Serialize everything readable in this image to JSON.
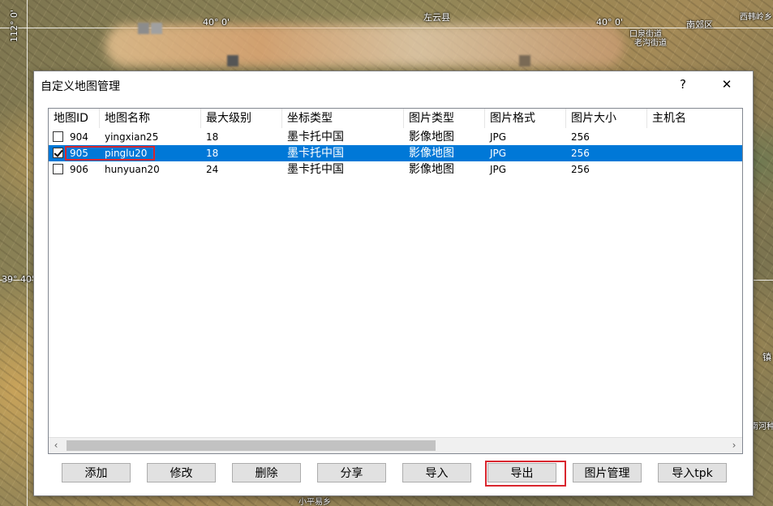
{
  "map": {
    "labels": [
      {
        "text": "40° 0'"
      },
      {
        "text": "左云县"
      },
      {
        "text": "40° 0'"
      },
      {
        "text": "南郊区"
      },
      {
        "text": "西韩岭乡"
      },
      {
        "text": "口泉街道"
      },
      {
        "text": "老沟街道"
      },
      {
        "text": "112° 0'"
      },
      {
        "text": "39° 40'"
      },
      {
        "text": "镇"
      },
      {
        "text": "南河种"
      },
      {
        "text": "小平易乡"
      }
    ]
  },
  "dialog": {
    "title": "自定义地图管理",
    "help_label": "?",
    "close_label": "✕",
    "columns": [
      "地图ID",
      "地图名称",
      "最大级别",
      "坐标类型",
      "图片类型",
      "图片格式",
      "图片大小",
      "主机名"
    ],
    "rows": [
      {
        "checked": false,
        "id": "904",
        "name": "yingxian25",
        "max_level": "18",
        "coord_type": "墨卡托中国",
        "image_type": "影像地图",
        "format": "JPG",
        "size": "256",
        "host": "",
        "selected": false
      },
      {
        "checked": true,
        "id": "905",
        "name": "pinglu20",
        "max_level": "18",
        "coord_type": "墨卡托中国",
        "image_type": "影像地图",
        "format": "JPG",
        "size": "256",
        "host": "",
        "selected": true
      },
      {
        "checked": false,
        "id": "906",
        "name": "hunyuan20",
        "max_level": "24",
        "coord_type": "墨卡托中国",
        "image_type": "影像地图",
        "format": "JPG",
        "size": "256",
        "host": "",
        "selected": false
      }
    ],
    "scroll_left": "‹",
    "scroll_right": "›",
    "buttons": {
      "add": "添加",
      "edit": "修改",
      "delete": "删除",
      "share": "分享",
      "import": "导入",
      "export": "导出",
      "image_manage": "图片管理",
      "import_tpk": "导入tpk"
    },
    "highlight_color": "#d9262e",
    "selection_color": "#0078d7"
  }
}
